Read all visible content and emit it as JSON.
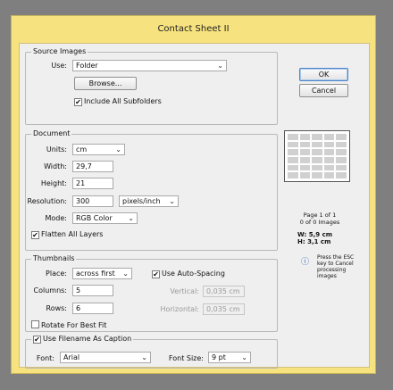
{
  "window": {
    "title": "Contact Sheet II"
  },
  "buttons": {
    "ok": "OK",
    "cancel": "Cancel"
  },
  "source_images": {
    "legend": "Source Images",
    "use_label": "Use:",
    "use_value": "Folder",
    "browse": "Browse...",
    "include_subfolders": "Include All Subfolders",
    "include_subfolders_checked": true
  },
  "document": {
    "legend": "Document",
    "units_label": "Units:",
    "units_value": "cm",
    "width_label": "Width:",
    "width_value": "29,7",
    "height_label": "Height:",
    "height_value": "21",
    "resolution_label": "Resolution:",
    "resolution_value": "300",
    "resolution_unit": "pixels/inch",
    "mode_label": "Mode:",
    "mode_value": "RGB Color",
    "flatten": "Flatten All Layers",
    "flatten_checked": true
  },
  "thumbnails": {
    "legend": "Thumbnails",
    "place_label": "Place:",
    "place_value": "across first",
    "columns_label": "Columns:",
    "columns_value": "5",
    "rows_label": "Rows:",
    "rows_value": "6",
    "rotate": "Rotate For Best Fit",
    "rotate_checked": false,
    "auto_spacing": "Use Auto-Spacing",
    "auto_spacing_checked": true,
    "vertical_label": "Vertical:",
    "vertical_value": "0,035 cm",
    "horizontal_label": "Horizontal:",
    "horizontal_value": "0,035 cm"
  },
  "caption": {
    "use_filename": "Use Filename As Caption",
    "use_filename_checked": true,
    "font_label": "Font:",
    "font_value": "Arial",
    "font_size_label": "Font Size:",
    "font_size_value": "9 pt"
  },
  "preview": {
    "page": "Page 1 of 1",
    "images": "0 of 0 Images",
    "w": "W: 5,9 cm",
    "h": "H: 3,1 cm",
    "hint": "Press the ESC key to Cancel processing images",
    "columns": 5,
    "rows": 6
  },
  "icons": {
    "check": "✔",
    "dropdown": "chevron-down-icon",
    "info": "info-icon"
  },
  "colors": {
    "title_bar": "#f6e27e",
    "dialog_bg": "#efefef",
    "default_button": "#4d84c7"
  }
}
